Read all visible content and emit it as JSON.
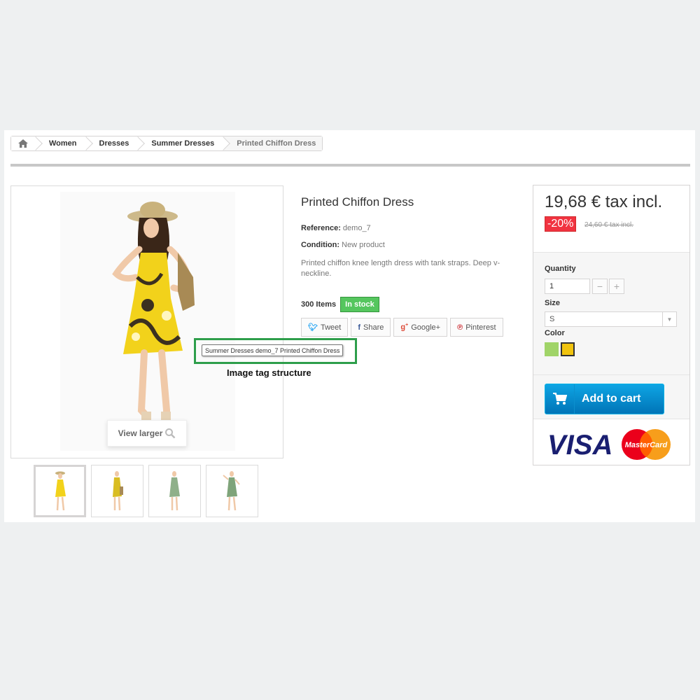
{
  "breadcrumb": {
    "items": [
      "Women",
      "Dresses",
      "Summer Dresses"
    ],
    "current": "Printed Chiffon Dress"
  },
  "image": {
    "view_larger_label": "View larger",
    "thumbnail_count": 4
  },
  "product": {
    "title": "Printed Chiffon Dress",
    "reference_label": "Reference:",
    "reference_value": "demo_7",
    "condition_label": "Condition:",
    "condition_value": "New product",
    "description": "Printed chiffon knee length dress with tank straps. Deep v-neckline.",
    "quantity_text": "300 Items",
    "stock_badge": "In stock"
  },
  "social": {
    "tweet": "Tweet",
    "share": "Share",
    "googleplus": "Google+",
    "pinterest": "Pinterest"
  },
  "annotation": {
    "tooltip_text": "Summer Dresses demo_7 Printed Chiffon Dress",
    "caption": "Image tag structure",
    "highlight_color": "#2e9e4b"
  },
  "buybox": {
    "price": "19,68 € tax incl.",
    "discount": "-20%",
    "old_price": "24,60 € tax incl.",
    "quantity_label": "Quantity",
    "quantity_value": "1",
    "size_label": "Size",
    "size_value": "S",
    "color_label": "Color",
    "colors": [
      "#a0d468",
      "#f1c40f"
    ],
    "selected_color_index": 1,
    "add_to_cart": "Add to cart"
  },
  "payment": {
    "visa": "VISA",
    "mastercard": "MasterCard"
  },
  "colors": {
    "accent_blue": "#0074b7",
    "in_stock_green": "#55c65e",
    "discount_red": "#f13340"
  }
}
